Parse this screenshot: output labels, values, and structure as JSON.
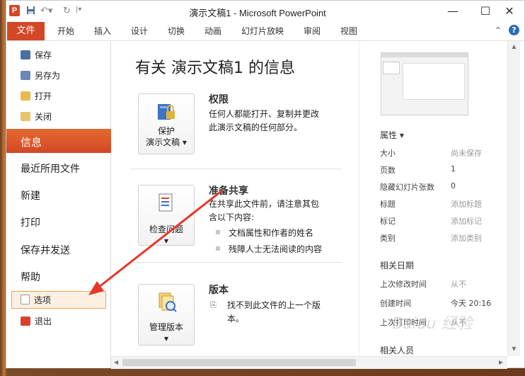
{
  "window": {
    "app_icon": "P",
    "title": "演示文稿1 - Microsoft PowerPoint",
    "minimize": "—",
    "maximize": "☐",
    "close": "✕"
  },
  "ribbon": {
    "file_tab": "文件",
    "tabs": [
      "开始",
      "插入",
      "设计",
      "切换",
      "动画",
      "幻灯片放映",
      "审阅",
      "视图"
    ]
  },
  "nav": {
    "small_top": [
      {
        "label": "保存",
        "icon": "save-icon"
      },
      {
        "label": "另存为",
        "icon": "save-as-icon"
      },
      {
        "label": "打开",
        "icon": "open-folder-icon"
      },
      {
        "label": "关闭",
        "icon": "close-folder-icon"
      }
    ],
    "active": "信息",
    "big": [
      "最近所用文件",
      "新建",
      "打印",
      "保存并发送",
      "帮助"
    ],
    "options": "选项",
    "exit": "退出"
  },
  "main": {
    "title": "有关 演示文稿1 的信息",
    "sections": [
      {
        "button_line1": "保护",
        "button_line2": "演示文稿",
        "heading": "权限",
        "text1": "任何人都能打开、复制并更改",
        "text2": "此演示文稿的任何部分。"
      },
      {
        "button_line1": "检查问题",
        "heading": "准备共享",
        "text1": "在共享此文件前，请注意其包",
        "text2": "含以下内容:",
        "bullets": [
          "文档属性和作者的姓名",
          "残障人士无法阅读的内容"
        ]
      },
      {
        "button_line1": "管理版本",
        "heading": "版本",
        "text1": "找不到此文件的上一个版",
        "text2": "本。"
      }
    ]
  },
  "properties": {
    "heading": "属性",
    "rows": [
      {
        "key": "大小",
        "value": "尚未保存"
      },
      {
        "key": "页数",
        "value": "1"
      },
      {
        "key": "隐藏幻灯片张数",
        "value": "0"
      },
      {
        "key": "标题",
        "value": "添加标题"
      },
      {
        "key": "标记",
        "value": "添加标记"
      },
      {
        "key": "类别",
        "value": "添加类别"
      }
    ],
    "dates_heading": "相关日期",
    "dates": [
      {
        "key": "上次修改时间",
        "value": "从不"
      },
      {
        "key": "创建时间",
        "value": "今天 20:16"
      },
      {
        "key": "上次打印时间",
        "value": "从不"
      }
    ],
    "people_heading": "相关人员"
  },
  "watermark": "Baidu 经验",
  "colors": {
    "accent": "#d24726",
    "annotation_arrow": "#e8362a"
  }
}
